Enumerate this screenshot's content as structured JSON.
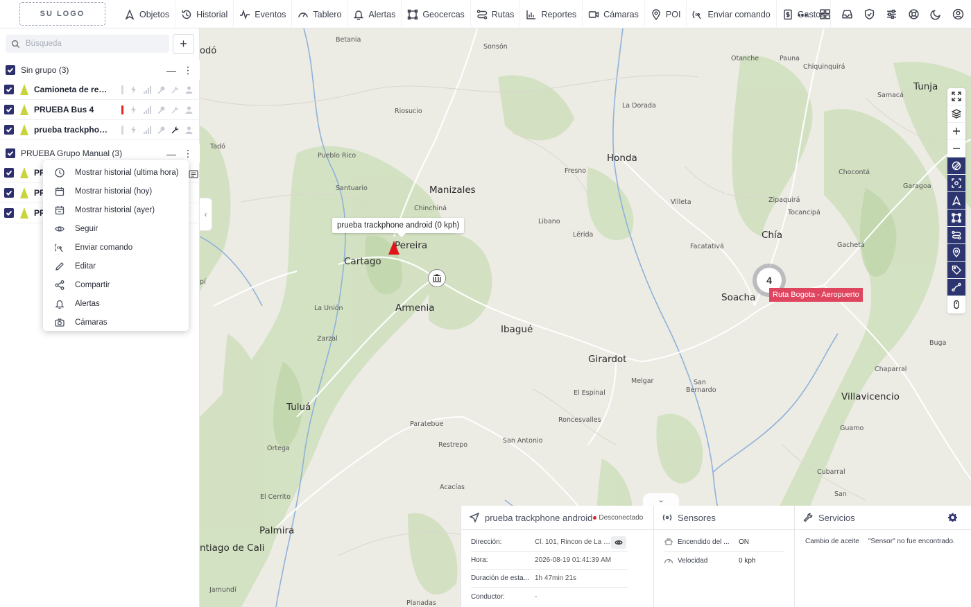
{
  "brand": {
    "logo_text": "SU LOGO"
  },
  "nav": {
    "items": [
      {
        "label": "Objetos",
        "icon": "navigation-arrow-icon"
      },
      {
        "label": "Historial",
        "icon": "history-icon"
      },
      {
        "label": "Eventos",
        "icon": "pulse-icon"
      },
      {
        "label": "Tablero",
        "icon": "gauge-icon"
      },
      {
        "label": "Alertas",
        "icon": "bell-icon"
      },
      {
        "label": "Geocercas",
        "icon": "geofence-icon"
      },
      {
        "label": "Rutas",
        "icon": "route-icon"
      },
      {
        "label": "Reportes",
        "icon": "bar-chart-icon"
      },
      {
        "label": "Cámaras",
        "icon": "camera-icon"
      },
      {
        "label": "POI",
        "icon": "map-pin-icon"
      },
      {
        "label": "Enviar comando",
        "icon": "satellite-icon"
      },
      {
        "label": "Gastos",
        "icon": "invoice-icon"
      }
    ],
    "right_icons": [
      "more-icon",
      "apps-grid-icon",
      "inbox-icon",
      "shield-check-icon",
      "sliders-icon",
      "support-icon",
      "moon-icon",
      "user-icon"
    ]
  },
  "sidebar": {
    "search": {
      "placeholder": "Búsqueda",
      "value": ""
    },
    "groups": [
      {
        "title": "Sin grupo (3)",
        "objects": [
          {
            "name": "Camioneta de rep...",
            "status_bar": "gray",
            "wrench_dark": false
          },
          {
            "name": "PRUEBA Bus 4",
            "status_bar": "red",
            "wrench_dark": false
          },
          {
            "name": "prueba trackphon...",
            "status_bar": "gray",
            "wrench_dark": true
          }
        ]
      },
      {
        "title": "PRUEBA Grupo Manual (3)",
        "objects": [
          {
            "name": "PR"
          },
          {
            "name": "PR"
          },
          {
            "name": "PR"
          }
        ]
      }
    ]
  },
  "context_menu": {
    "items": [
      {
        "label": "Mostrar historial (ultima hora)",
        "icon": "clock-icon"
      },
      {
        "label": "Mostrar historial (hoy)",
        "icon": "calendar-icon"
      },
      {
        "label": "Mostrar historial (ayer)",
        "icon": "calendar-back-icon"
      },
      {
        "label": "Seguir",
        "icon": "eye-icon"
      },
      {
        "label": "Enviar comando",
        "icon": "satellite-icon"
      },
      {
        "label": "Editar",
        "icon": "pencil-icon"
      },
      {
        "label": "Compartir",
        "icon": "share-icon"
      },
      {
        "label": "Alertas",
        "icon": "bell-icon"
      },
      {
        "label": "Cámaras",
        "icon": "camera-icon"
      }
    ]
  },
  "map": {
    "tooltip": "prueba trackphone android (0 kph)",
    "cluster_count": "4",
    "route_tag": "Ruta Bogota - Aeropuerto",
    "labels": {
      "large": [
        "Manizales",
        "Pereira",
        "Cartago",
        "Armenia",
        "Honda",
        "Ibagué",
        "Girardot",
        "Chía",
        "Soacha",
        "Tunja",
        "Tuluá",
        "Palmira",
        "ntiago de Cali",
        "Villavicencio"
      ],
      "small": [
        "odó",
        "Betania",
        "Sonsón",
        "Otanche",
        "Pauna",
        "Chiquinquirá",
        "Samacá",
        "Riosucio",
        "La Dorada",
        "Tadó",
        "Pueblo Rico",
        "Fresno",
        "Chocontá",
        "Santuario",
        "Garagoa",
        "Chinchiná",
        "Zipaquirá",
        "Villeta",
        "Tocancipá",
        "Libano",
        "Lérida",
        "Facatativá",
        "Gachetá",
        "La Unión",
        "Zarzal",
        "Melgar",
        "San Bernardo",
        "El Espinal",
        "Paratebue",
        "Restrepo",
        "Roncesvalles",
        "San Antonio",
        "Guamo",
        "Ortega",
        "Acacías",
        "Buga",
        "Chaparral",
        "Cubarral",
        "El Cerrito",
        "Jamundí",
        "Planadas",
        "San",
        "pí"
      ]
    }
  },
  "tools": [
    "expand-icon",
    "layers-icon",
    "zoom-in-icon",
    "zoom-out-icon",
    "geofence-toggle-icon",
    "focus-icon",
    "objects-toggle-icon",
    "polygon-icon",
    "route-toggle-icon",
    "poi-toggle-icon",
    "tag-icon",
    "path-icon",
    "mouse-icon"
  ],
  "object_panel": {
    "title": "prueba trackphone android",
    "status": "Desconectado",
    "rows": [
      {
        "key": "Dirección:",
        "value": "Cl. 101, Rincon de La P..."
      },
      {
        "key": "Hora:",
        "value": "2026-08-19 01:41:39 AM"
      },
      {
        "key": "Duración de esta...",
        "value": "1h 47min 21s"
      },
      {
        "key": "Conductor:",
        "value": "-"
      }
    ]
  },
  "sensors_panel": {
    "title": "Sensores",
    "rows": [
      {
        "key": "Encendido del ...",
        "value": "ON",
        "icon": "engine-icon"
      },
      {
        "key": "Velocidad",
        "value": "0 kph",
        "icon": "speedometer-icon"
      }
    ]
  },
  "services_panel": {
    "title": "Servicios",
    "service": "Cambio de aceite",
    "message": "\"Sensor\" no fue encontrado."
  },
  "colors": {
    "accent": "#2d2f6e",
    "alert_red": "#e02424",
    "route_tag": "#e04560",
    "map_bg": "#ecebe4"
  }
}
